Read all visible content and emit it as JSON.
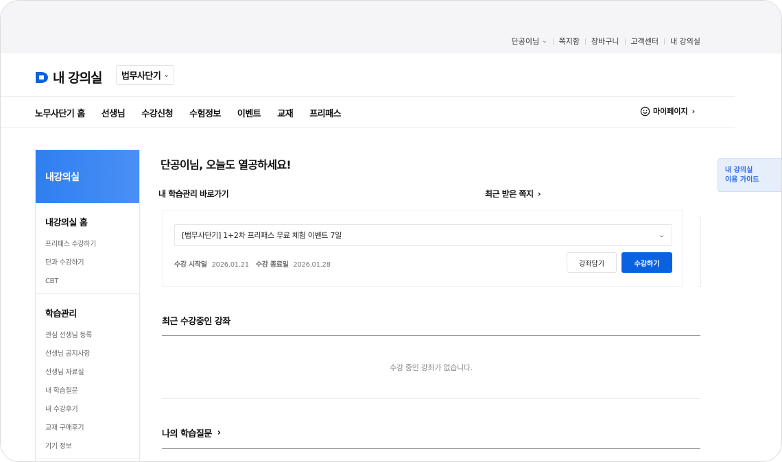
{
  "utility_nav": {
    "user": "단공이님",
    "items": [
      "쪽지함",
      "장바구니",
      "고객센터",
      "내 강의실"
    ]
  },
  "header": {
    "logo_text": "내 강의실",
    "site_select": "법무사단기"
  },
  "gnb": {
    "items": [
      "노무사단기 홈",
      "선생님",
      "수강신청",
      "수험정보",
      "이벤트",
      "교재",
      "프리패스"
    ],
    "mypage": "마이페이지"
  },
  "sidebar": {
    "title": "내강의실",
    "sections": [
      {
        "title": "내강의실 홈",
        "links": [
          "프리패스 수강하기",
          "단과 수강하기",
          "CBT"
        ]
      },
      {
        "title": "학습관리",
        "links": [
          "관심 선생님 등록",
          "선생님 공지사항",
          "선생님 자료실",
          "내 학습질문",
          "내 수강후기",
          "교재 구매후기",
          "기기 정보"
        ]
      }
    ]
  },
  "main": {
    "greeting": "단공이님, 오늘도 열공하세요!",
    "shortcut_label": "내 학습관리 바로가기",
    "recent_messages": "최근 받은 쪽지",
    "course_card": {
      "selected_course": "[법무사단기] 1+2차 프리패스 무료 체험 이벤트 7일",
      "start_label": "수강 시작일",
      "start_date": "2026.01.21",
      "end_label": "수강 종료일",
      "end_date": "2026.01.28",
      "cart_button": "강좌담기",
      "enroll_button": "수강하기"
    },
    "recent_courses_title": "최근 수강중인 강좌",
    "recent_courses_empty": "수강 중인 강좌가 없습니다.",
    "my_questions_title": "나의 학습질문"
  },
  "guide": {
    "line1": "내 강의실",
    "line2": "이용 가이드"
  },
  "colors": {
    "accent": "#0b62e0",
    "sidebar_header": "#2f7ff0",
    "guide_bg": "#e6eefc"
  }
}
